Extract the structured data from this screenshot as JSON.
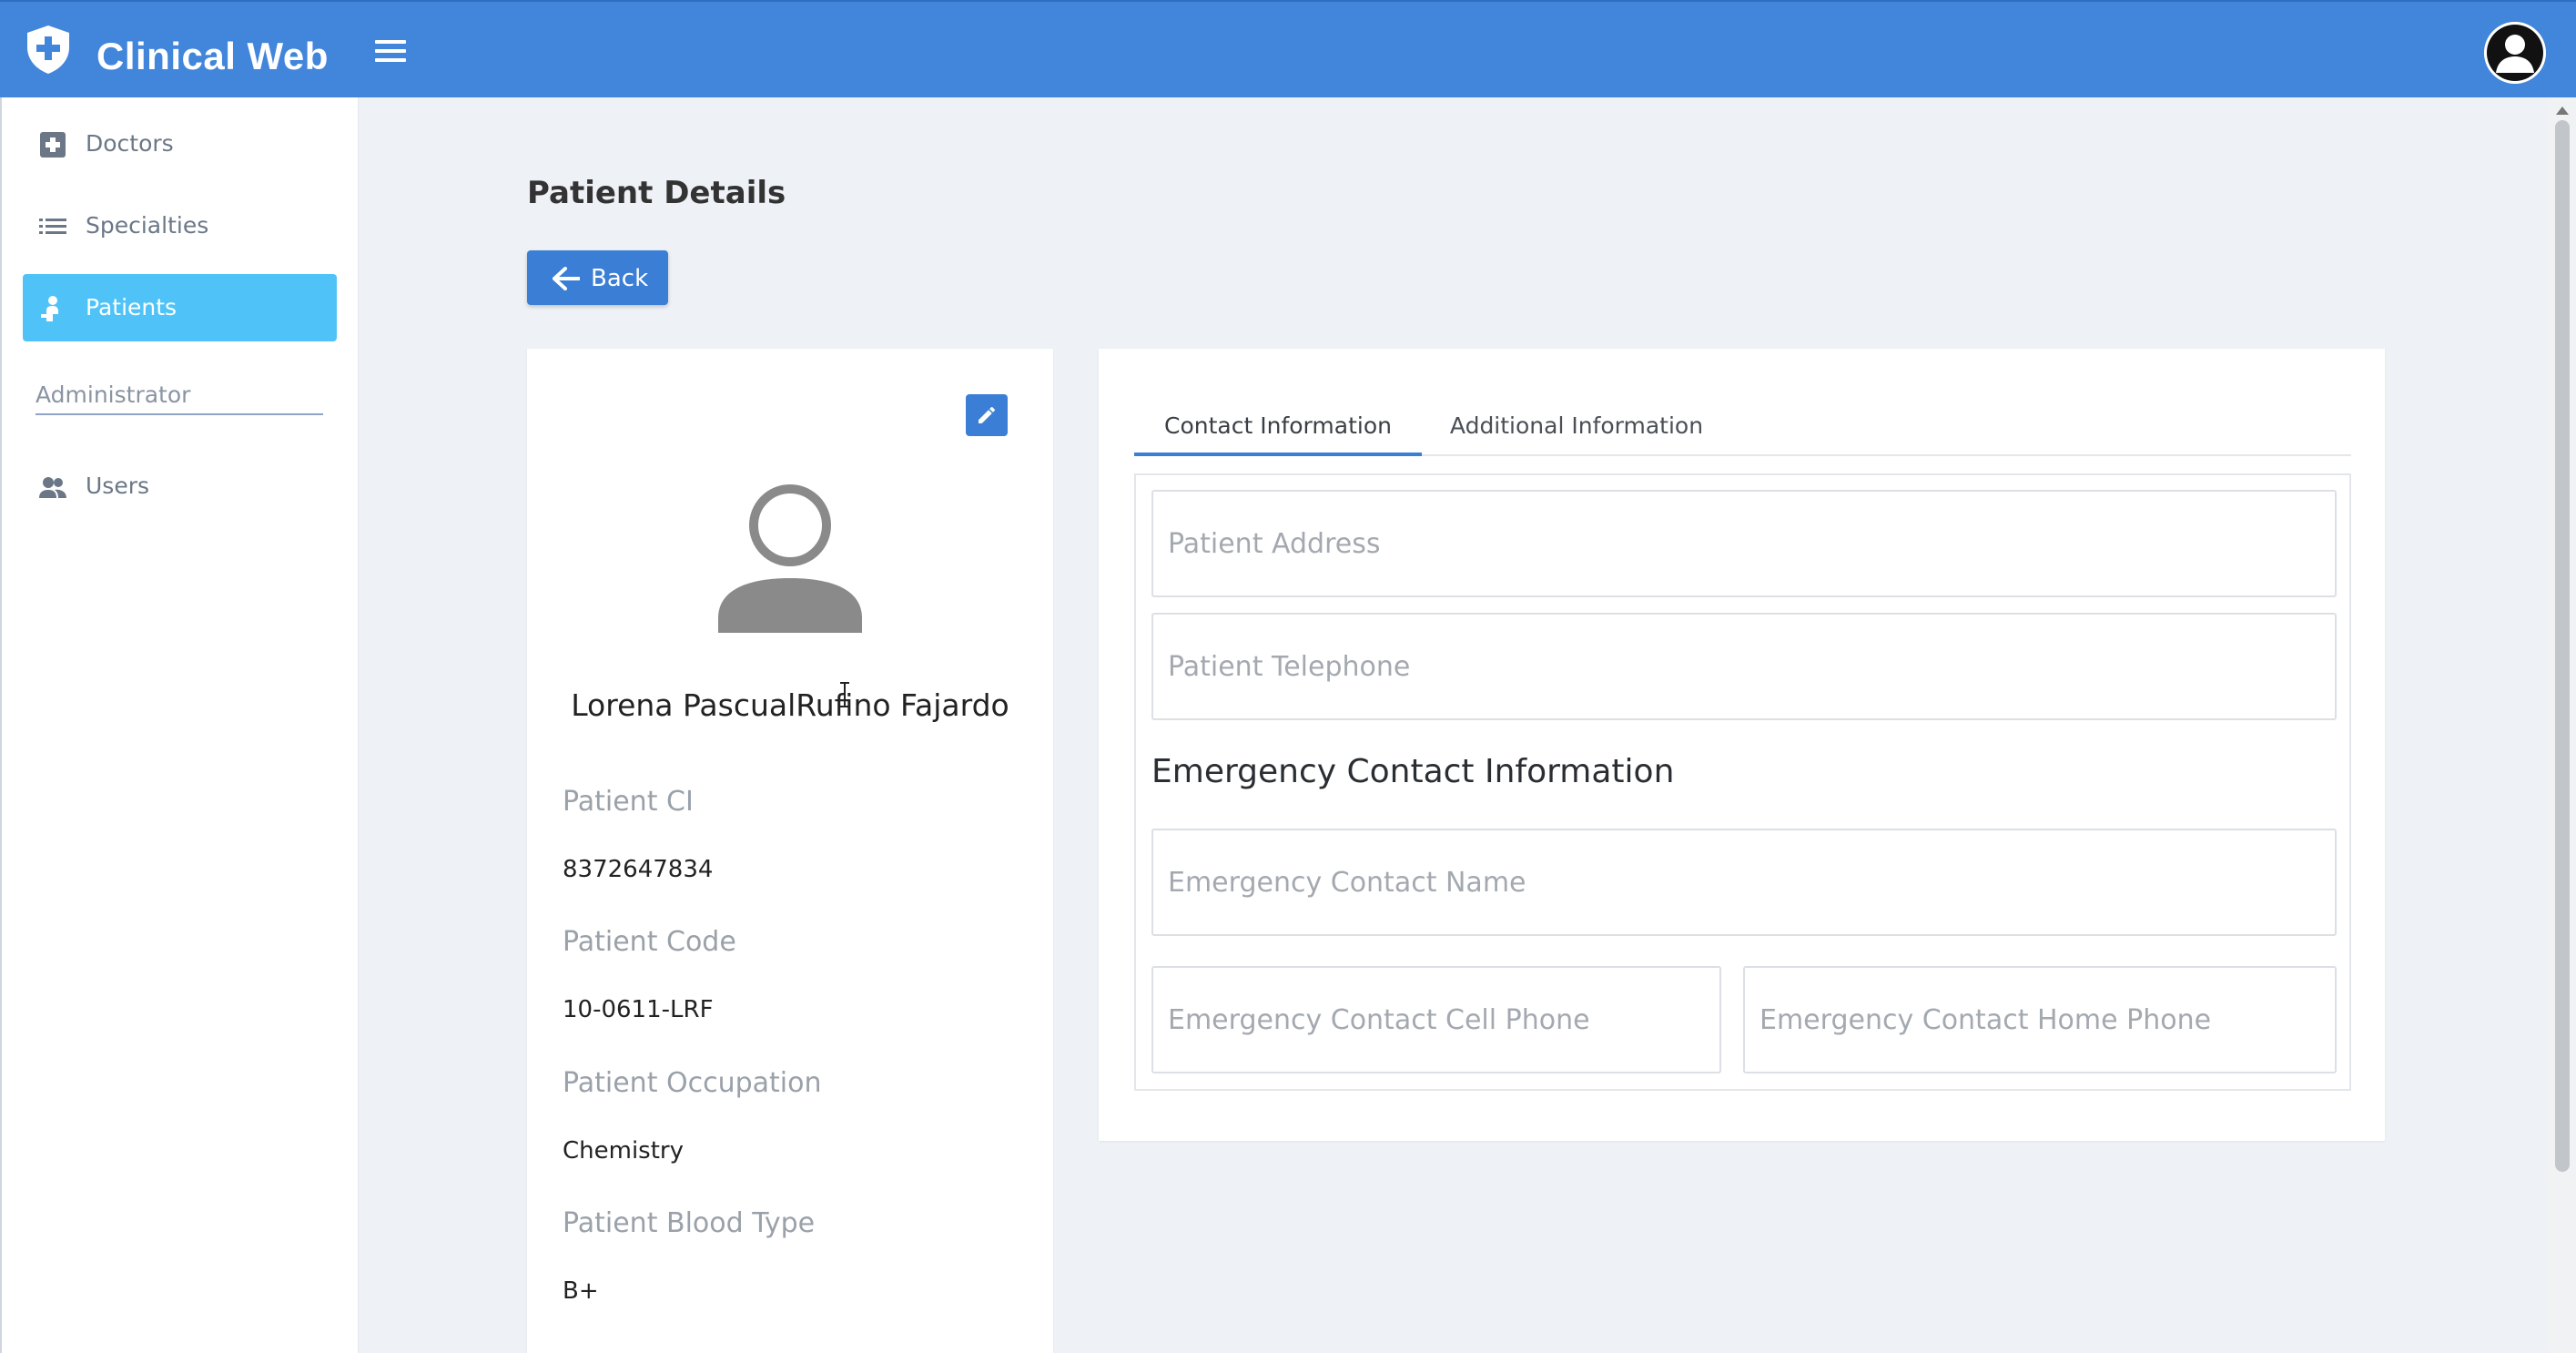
{
  "app": {
    "title": "Clinical Web",
    "brand_color": "#4286db",
    "logo_icon": "shield-plus-icon",
    "menu_icon": "hamburger-icon",
    "user_icon": "user-avatar-icon"
  },
  "sidebar": {
    "items": [
      {
        "label": "Doctors",
        "icon": "medical-plus-icon",
        "active": false
      },
      {
        "label": "Specialties",
        "icon": "list-icon",
        "active": false
      },
      {
        "label": "Patients",
        "icon": "patient-icon",
        "active": true
      }
    ],
    "section_label": "Administrator",
    "admin_items": [
      {
        "label": "Users",
        "icon": "users-icon",
        "active": false
      }
    ],
    "active_color": "#4fc3f7"
  },
  "main": {
    "page_title": "Patient Details",
    "back_label": "Back"
  },
  "profile": {
    "name": "Lorena PascualRufino Fajardo",
    "fields": [
      {
        "label": "Patient CI",
        "value": "8372647834"
      },
      {
        "label": "Patient Code",
        "value": "10-0611-LRF"
      },
      {
        "label": "Patient Occupation",
        "value": "Chemistry"
      },
      {
        "label": "Patient Blood Type",
        "value": "B+"
      }
    ]
  },
  "info": {
    "tabs": [
      {
        "label": "Contact Information",
        "active": true
      },
      {
        "label": "Additional Information",
        "active": false
      }
    ],
    "contact": {
      "address_placeholder": "Patient Address",
      "telephone_placeholder": "Patient Telephone"
    },
    "emergency": {
      "heading": "Emergency Contact Information",
      "name_placeholder": "Emergency Contact Name",
      "cell_placeholder": "Emergency Contact Cell Phone",
      "home_placeholder": "Emergency Contact Home Phone"
    }
  }
}
